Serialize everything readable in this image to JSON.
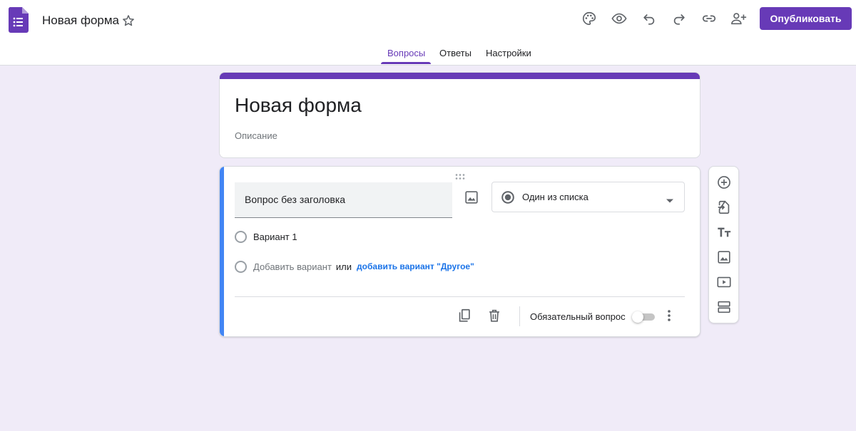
{
  "header": {
    "doc_title": "Новая форма",
    "publish_label": "Опубликовать",
    "icons": [
      "forms-logo-icon",
      "star-icon",
      "palette-icon",
      "preview-eye-icon",
      "undo-icon",
      "redo-icon",
      "link-icon",
      "add-collaborator-icon"
    ]
  },
  "tabs": [
    {
      "label": "Вопросы",
      "active": true
    },
    {
      "label": "Ответы",
      "active": false
    },
    {
      "label": "Настройки",
      "active": false
    }
  ],
  "form": {
    "title": "Новая форма",
    "description_placeholder": "Описание"
  },
  "question": {
    "title": "Вопрос без заголовка",
    "type_label": "Один из списка",
    "option_1": "Вариант 1",
    "add_option": "Добавить вариант",
    "or_text": "или",
    "add_other": "добавить вариант \"Другое\"",
    "required_label": "Обязательный вопрос",
    "required_on": false
  },
  "side_toolbar": [
    "add-question-icon",
    "import-questions-icon",
    "add-title-icon",
    "add-image-icon",
    "add-video-icon",
    "add-section-icon"
  ],
  "colors": {
    "accent": "#673ab7",
    "background": "#f0ebf8",
    "active_question_bar": "#4285f4",
    "link": "#1a73e8"
  }
}
